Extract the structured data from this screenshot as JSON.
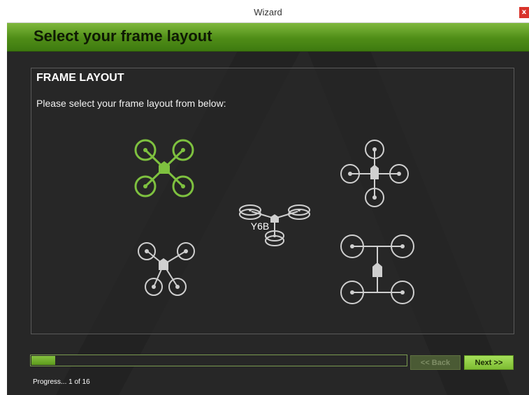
{
  "window": {
    "title": "Wizard",
    "close_label": "x"
  },
  "header": {
    "title": "Select your frame layout"
  },
  "panel": {
    "title": "FRAME LAYOUT",
    "description": "Please select your frame layout from below:"
  },
  "frames": [
    {
      "id": "x",
      "selected": true
    },
    {
      "id": "plus",
      "selected": false
    },
    {
      "id": "y6b",
      "label": "Y6B",
      "selected": false
    },
    {
      "id": "v",
      "selected": false
    },
    {
      "id": "h",
      "selected": false
    }
  ],
  "navigation": {
    "back_label": "<< Back",
    "next_label": "Next >>",
    "back_enabled": false
  },
  "progress": {
    "text": "Progress... 1 of 16",
    "fraction": 0.0625
  },
  "colors": {
    "accent": "#7fb83d",
    "selected_frame": "#7ec13f",
    "unselected_frame": "#cfcfcf",
    "background": "#272727"
  }
}
